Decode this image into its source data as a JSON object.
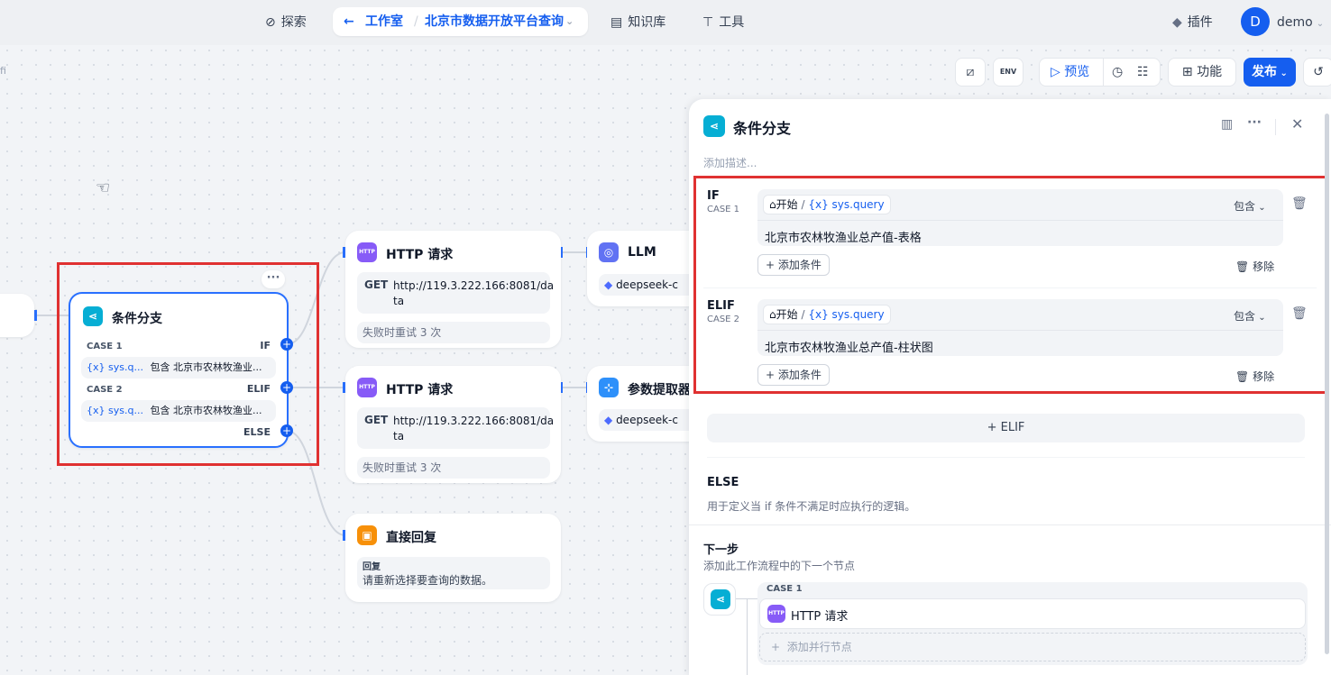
{
  "nav": {
    "explore": "探索",
    "studio": "工作室",
    "app_name": "北京市数据开放平台查询",
    "knowledge": "知识库",
    "tools": "工具",
    "plugins": "插件",
    "avatar_letter": "D",
    "user": "demo",
    "left_cut_text": "fi"
  },
  "toolbar": {
    "env": "ENV",
    "preview": "预览",
    "features": "功能",
    "publish": "发布"
  },
  "canvas": {
    "branch_node": {
      "title": "条件分支",
      "case1_label": "CASE 1",
      "if": "IF",
      "case1_var": "sys.q...",
      "case1_op": "包含",
      "case1_val": "北京市农林牧渔业...",
      "case2_label": "CASE 2",
      "elif": "ELIF",
      "case2_var": "sys.q...",
      "case2_op": "包含",
      "case2_val": "北京市农林牧渔业...",
      "else": "ELSE",
      "more": "···"
    },
    "http1": {
      "title": "HTTP 请求",
      "method": "GET",
      "url": "http://119.3.222.166:8081/da",
      "url2": "ta",
      "retry": "失败时重试 3 次",
      "icon_text": "HTTP"
    },
    "http2": {
      "title": "HTTP 请求",
      "method": "GET",
      "url": "http://119.3.222.166:8081/da",
      "url2": "ta",
      "retry": "失败时重试 3 次",
      "icon_text": "HTTP"
    },
    "llm": {
      "title": "LLM",
      "model": "deepseek-c"
    },
    "param": {
      "title": "参数提取器",
      "model": "deepseek-c"
    },
    "reply": {
      "title": "直接回复",
      "label": "回复",
      "text": "请重新选择要查询的数据。"
    },
    "var_prefix": "{x}"
  },
  "panel": {
    "title": "条件分支",
    "desc_placeholder": "添加描述...",
    "if": {
      "label": "IF",
      "case": "CASE 1",
      "start": "开始",
      "var": "sys.query",
      "op": "包含",
      "value": "北京市农林牧渔业总产值-表格",
      "add": "添加条件",
      "remove": "移除"
    },
    "elif": {
      "label": "ELIF",
      "case": "CASE 2",
      "start": "开始",
      "var": "sys.query",
      "op": "包含",
      "value": "北京市农林牧渔业总产值-柱状图",
      "add": "添加条件",
      "remove": "移除"
    },
    "add_elif": "+ ELIF",
    "else": {
      "label": "ELSE",
      "desc": "用于定义当 if 条件不满足时应执行的逻辑。"
    },
    "next": {
      "title": "下一步",
      "desc": "添加此工作流程中的下一个节点",
      "case": "CASE 1",
      "node": "HTTP 请求",
      "add_parallel": "添加并行节点",
      "icon_text": "HTTP"
    }
  },
  "colors": {
    "accent": "#155eef",
    "highlight": "#e03131",
    "branch": "#06aed4",
    "http": "#875bf7",
    "reply": "#f79009"
  }
}
